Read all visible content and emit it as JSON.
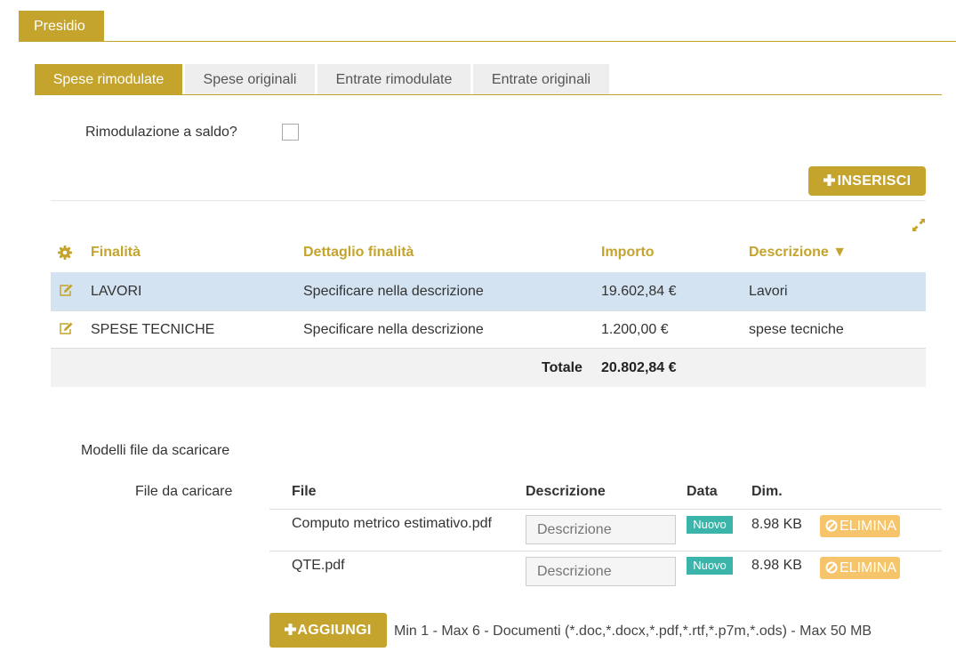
{
  "top_tab": {
    "label": "Presidio"
  },
  "tabs": [
    {
      "label": "Spese rimodulate",
      "active": true
    },
    {
      "label": "Spese originali",
      "active": false
    },
    {
      "label": "Entrate rimodulate",
      "active": false
    },
    {
      "label": "Entrate originali",
      "active": false
    }
  ],
  "rimodulazione": {
    "label": "Rimodulazione a saldo?",
    "checked": false
  },
  "insert_button": {
    "label": "INSERISCI",
    "icon": "plus-icon"
  },
  "table": {
    "headers": {
      "finalita": "Finalità",
      "dettaglio": "Dettaglio finalità",
      "importo": "Importo",
      "descrizione": "Descrizione ▼"
    },
    "rows": [
      {
        "finalita": "LAVORI",
        "dettaglio": "Specificare nella descrizione",
        "importo": "19.602,84 €",
        "descrizione": "Lavori",
        "selected": true
      },
      {
        "finalita": "SPESE TECNICHE",
        "dettaglio": "Specificare nella descrizione",
        "importo": "1.200,00 €",
        "descrizione": "spese tecniche",
        "selected": false
      }
    ],
    "footer": {
      "label": "Totale",
      "value": "20.802,84 €"
    }
  },
  "uploads": {
    "models_label": "Modelli file da scaricare",
    "files_label": "File da caricare",
    "headers": {
      "file": "File",
      "descrizione": "Descrizione",
      "data": "Data",
      "dim": "Dim."
    },
    "files": [
      {
        "name": "Computo metrico estimativo.pdf",
        "desc_placeholder": "Descrizione",
        "badge": "Nuovo",
        "size": "8.98 KB",
        "delete_label": "ELIMINA"
      },
      {
        "name": "QTE.pdf",
        "desc_placeholder": "Descrizione",
        "badge": "Nuovo",
        "size": "8.98 KB",
        "delete_label": "ELIMINA"
      }
    ],
    "add_button": {
      "label": "AGGIUNGI"
    },
    "note": "Min 1 - Max 6 - Documenti (*.doc,*.docx,*.pdf,*.rtf,*.p7m,*.ods) - Max 50 MB"
  },
  "colors": {
    "accent": "#c4a42c",
    "selected_row": "#d4e3f1",
    "badge": "#3bb5a9",
    "delete": "#f6c46a"
  }
}
